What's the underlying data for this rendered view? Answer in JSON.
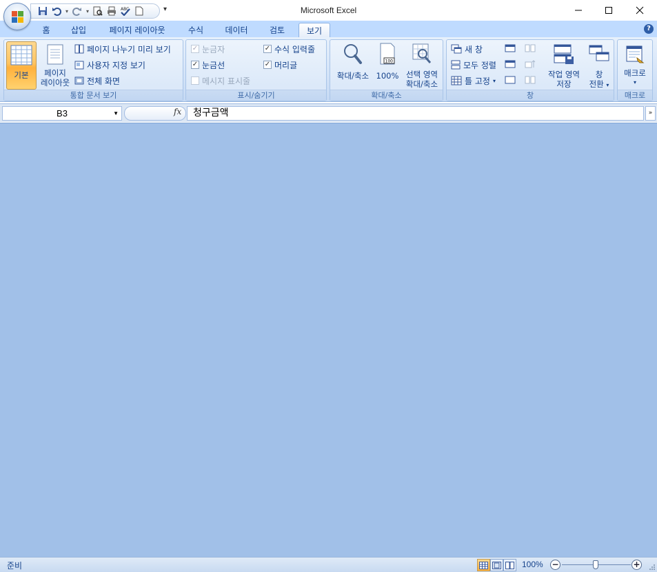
{
  "window": {
    "title": "Microsoft Excel",
    "minimize_icon": "minimize-icon",
    "maximize_icon": "maximize-icon",
    "close_icon": "close-icon"
  },
  "quick_access": {
    "icons": [
      "save-icon",
      "undo-icon",
      "redo-icon",
      "print-preview-icon",
      "print-icon",
      "spelling-icon",
      "new-icon"
    ]
  },
  "tabs": [
    {
      "label": "홈",
      "active": false
    },
    {
      "label": "삽입",
      "active": false
    },
    {
      "label": "페이지 레이아웃",
      "active": false
    },
    {
      "label": "수식",
      "active": false
    },
    {
      "label": "데이터",
      "active": false
    },
    {
      "label": "검토",
      "active": false
    },
    {
      "label": "보기",
      "active": true
    }
  ],
  "ribbon": {
    "workbook_views": {
      "label": "통합 문서 보기",
      "normal": "기본",
      "page_layout_line1": "페이지",
      "page_layout_line2": "레이아웃",
      "page_break_preview": "페이지 나누기 미리 보기",
      "custom_views": "사용자 지정 보기",
      "full_screen": "전체 화면"
    },
    "show_hide": {
      "label": "표시/숨기기",
      "ruler": "눈금자",
      "gridlines": "눈금선",
      "message_bar": "메시지 표시줄",
      "formula_bar": "수식 입력줄",
      "headings": "머리글",
      "ruler_checked": true,
      "gridlines_checked": true,
      "message_bar_checked": false,
      "formula_bar_checked": true,
      "headings_checked": true
    },
    "zoom": {
      "label": "확대/축소",
      "zoom": "확대/축소",
      "hundred": "100%",
      "selection_line1": "선택 영역",
      "selection_line2": "확대/축소"
    },
    "window": {
      "label": "창",
      "new_window": "새 창",
      "arrange_all": "모두 정렬",
      "freeze_panes": "틀 고정",
      "save_workspace_line1": "작업 영역",
      "save_workspace_line2": "저장",
      "switch_line1": "창",
      "switch_line2": "전환"
    },
    "macros": {
      "label": "매크로",
      "button": "매크로"
    }
  },
  "formula_bar": {
    "name_box": "B3",
    "fx": "fx",
    "content": "청구금액"
  },
  "status_bar": {
    "status": "준비",
    "zoom": "100%"
  },
  "colors": {
    "workspace": "#a1c0e8",
    "ribbon_text": "#15428b",
    "active_button": "#ffc461"
  }
}
